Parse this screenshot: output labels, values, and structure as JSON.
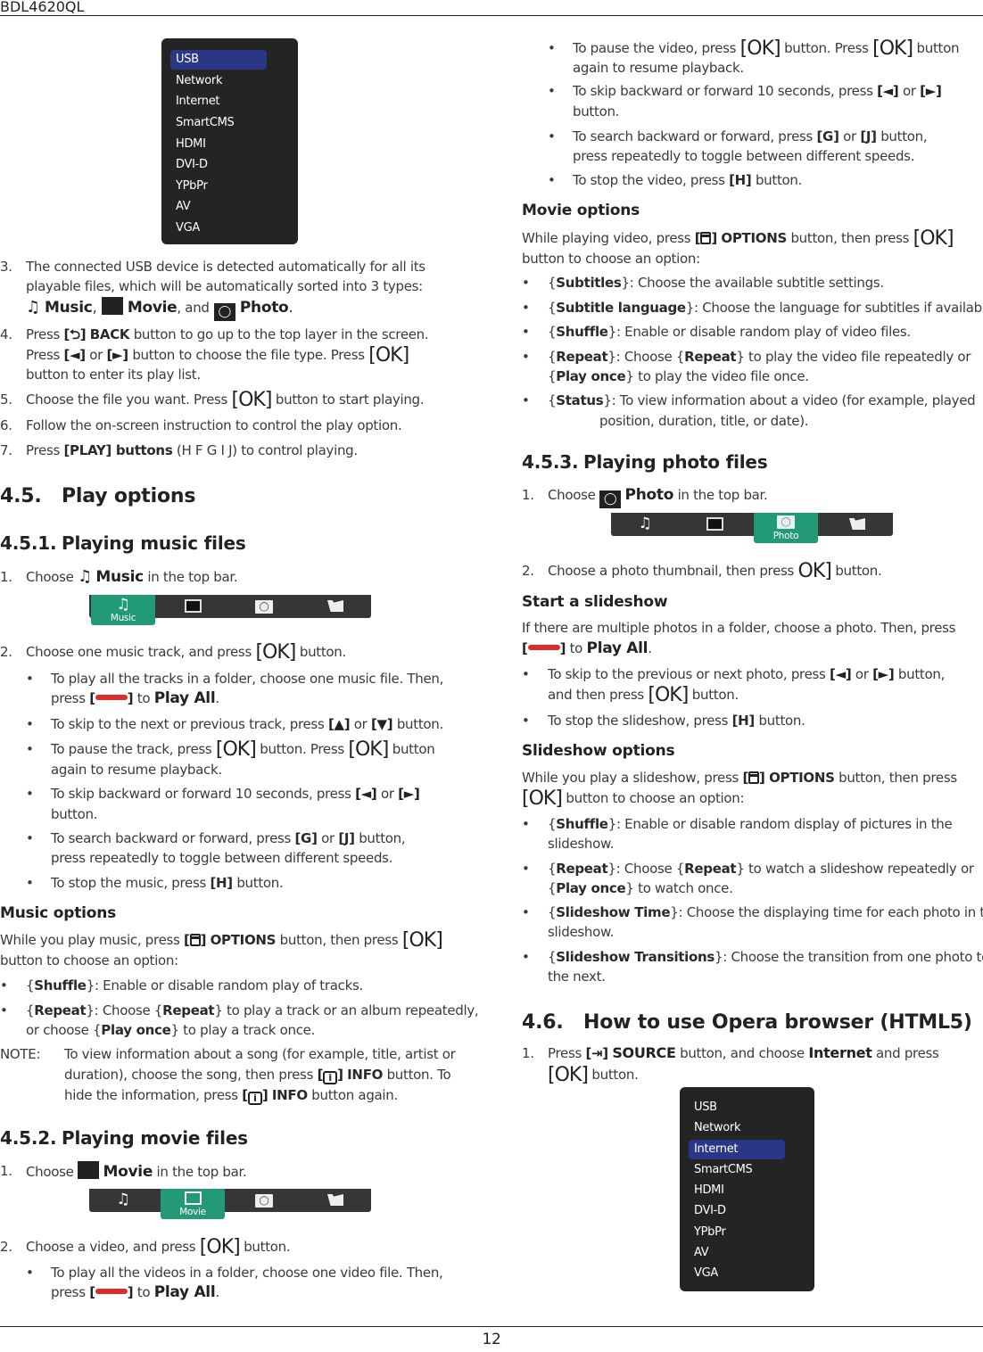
{
  "header": {
    "model": "BDL4620QL"
  },
  "footer": {
    "page_number": "12"
  },
  "source_menu_1": {
    "items": [
      "USB",
      "Network",
      "Internet",
      "SmartCMS",
      "HDMI",
      "DVI-D",
      "YPbPr",
      "AV",
      "VGA"
    ],
    "selected": "USB",
    "selected_color": "#2a3686"
  },
  "source_menu_2": {
    "items": [
      "USB",
      "Network",
      "Internet",
      "SmartCMS",
      "HDMI",
      "DVI-D",
      "YPbPr",
      "AV",
      "VGA"
    ],
    "selected": "Internet"
  },
  "steps_intro": {
    "s3_num": "3.",
    "s3_l1": "The connected USB device is detected automatically for all its",
    "s3_l2": "playable files, which will be automatically sorted into 3 types:",
    "music": "Music",
    "movie": "Movie",
    "and": ", and",
    "photo": "Photo",
    "s4_num": "4.",
    "s4_press": "Press",
    "s4_back": "BACK",
    "s4_l1_rest": "button to go up to the top layer in the screen.",
    "s4_l2_a": "Press",
    "s4_l2_or": "or",
    "s4_l2_b": "button to choose the file type. Press",
    "s4_l3": "button to enter its play list.",
    "s5_num": "5.",
    "s5_a": "Choose the file you want. Press",
    "s5_b": "button to start playing.",
    "s6_num": "6.",
    "s6": "Follow the on-screen instruction to control the play option.",
    "s7_num": "7.",
    "s7_a": "Press",
    "s7_play": "[PLAY] buttons",
    "s7_keys": "(H F G I J)",
    "s7_b": "to control playing."
  },
  "sections": {
    "s45_num": "4.5.",
    "s45_title": "Play options",
    "s451_num": "4.5.1.",
    "s451_title": "Playing music files",
    "s452_num": "4.5.2.",
    "s452_title": "Playing movie files",
    "s453_num": "4.5.3.",
    "s453_title": "Playing photo files",
    "s46_num": "4.6.",
    "s46_title": "How to use Opera browser (HTML5)"
  },
  "topbar": {
    "tabs": [
      "Music",
      "Movie",
      "Photo",
      "Files"
    ],
    "active_color": "#229977"
  },
  "music": {
    "step1_num": "1.",
    "step1_a": "Choose",
    "step1_label": "Music",
    "step1_b": "in the top bar.",
    "step2_num": "2.",
    "step2_a": "Choose one music track, and press",
    "step2_b": "button.",
    "b1_l1": "To play all the tracks in a folder, choose one music file. Then,",
    "b1_l2a": "press",
    "b1_to": "to",
    "play_all": "Play All",
    "b2_a": "To skip to the next or previous track, press",
    "b2_or": "or",
    "b2_b": "button.",
    "b3_a": "To pause the track, press",
    "b3_b": "button. Press",
    "b3_c": "button",
    "b3_l2": "again to resume playback.",
    "b4_a": "To skip backward or forward 10 seconds, press",
    "b4_or": "or",
    "b4_l2": "button.",
    "b5_a": "To search backward or forward, press",
    "b5_g": "[G]",
    "b5_or": "or",
    "b5_j": "[J]",
    "b5_b": "button,",
    "b5_l2": "press repeatedly to toggle between different speeds.",
    "b6_a": "To stop the music, press",
    "b6_h": "[H]",
    "b6_b": "button.",
    "opt_title": "Music options",
    "opt_l1a": "While you play music, press",
    "opt_options": "OPTIONS",
    "opt_l1b": "button, then press",
    "opt_l2": "button to choose an option:",
    "o1_name": "Shuffle",
    "o1_desc": ": Enable or disable random play of tracks.",
    "o2_name": "Repeat",
    "o2_a": ": Choose",
    "o2_b": "to play a track or an album repeatedly,",
    "o2_l2a": "or choose",
    "o2_playonce": "Play once",
    "o2_l2b": "to play a track once.",
    "note_label": "NOTE:",
    "note_l1": "To view information about a song (for example, title, artist or",
    "note_l2a": "duration), choose the song, then press",
    "note_info": "INFO",
    "note_l2b": "button. To",
    "note_l3a": "hide the information, press",
    "note_l3b": "button again."
  },
  "movie": {
    "step1_num": "1.",
    "step1_a": "Choose",
    "step1_label": "Movie",
    "step1_b": "in the top bar.",
    "step2_num": "2.",
    "step2_a": "Choose a video, and press",
    "step2_b": "button.",
    "b1_l1": "To play all the videos in a folder, choose one video file. Then,",
    "b1_l2a": "press",
    "b1_to": "to",
    "play_all": "Play All",
    "b2_a": "To pause the video, press",
    "b2_b": "button. Press",
    "b2_c": "button",
    "b2_l2": "again to resume playback.",
    "b3_a": "To skip backward or forward 10 seconds, press",
    "b3_or": "or",
    "b3_l2": "button.",
    "b4_a": "To search backward or forward, press",
    "b4_g": "[G]",
    "b4_or": "or",
    "b4_j": "[J]",
    "b4_b": "button,",
    "b4_l2": "press repeatedly to toggle between different speeds.",
    "b5_a": "To stop the video, press",
    "b5_h": "[H]",
    "b5_b": "button.",
    "opt_title": "Movie options",
    "opt_l1a": "While playing video, press",
    "opt_options": "OPTIONS",
    "opt_l1b": "button, then press",
    "opt_l2": "button to choose an option:",
    "o1_name": "Subtitles",
    "o1_desc": ": Choose the available subtitle settings.",
    "o2_name": "Subtitle language",
    "o2_desc": ": Choose the language for subtitles if available.",
    "o3_name": "Shuffle",
    "o3_desc": ": Enable or disable random play of video files.",
    "o4_name": "Repeat",
    "o4_a": ": Choose",
    "o4_b": "to play the video file repeatedly or",
    "o4_playonce": "Play once",
    "o4_l2b": "to play the video file once.",
    "o5_name": "Status",
    "o5_l1": ": To view information about a video (for example, played",
    "o5_l2": "position, duration, title, or date)."
  },
  "photo": {
    "step1_num": "1.",
    "step1_a": "Choose",
    "step1_label": "Photo",
    "step1_b": "in the top bar.",
    "step2_num": "2.",
    "step2_a": "Choose a photo thumbnail, then press",
    "step2_b": "button.",
    "slide_title": "Start a slideshow",
    "slide_l1": "If there are multiple photos in a folder, choose a photo. Then, press",
    "slide_to": "to",
    "play_all": "Play All",
    "b1_a": "To skip to the previous or next photo, press",
    "b1_or": "or",
    "b1_b": "button,",
    "b1_l2a": "and then press",
    "b1_l2b": "button.",
    "b2_a": "To stop the slideshow, press",
    "b2_h": "[H]",
    "b2_b": "button.",
    "opt_title": "Slideshow options",
    "opt_l1a": "While you play a slideshow, press",
    "opt_options": "OPTIONS",
    "opt_l1b": "button, then press",
    "opt_l2": "button to choose an option:",
    "o1_name": "Shuffle",
    "o1_l1": ": Enable or disable random display of pictures in the",
    "o1_l2": "slideshow.",
    "o2_name": "Repeat",
    "o2_a": ": Choose",
    "o2_b": "to watch a slideshow repeatedly or",
    "o2_playonce": "Play once",
    "o2_l2b": "to watch once.",
    "o3_name": "Slideshow Time",
    "o3_l1": ": Choose the displaying time for each photo in the",
    "o3_l2": "slideshow.",
    "o4_name": "Slideshow Transitions",
    "o4_l1": ": Choose the transition from one photo to",
    "o4_l2": "the next."
  },
  "opera": {
    "step1_num": "1.",
    "step1_a": "Press",
    "source": "SOURCE",
    "step1_b": "button, and choose",
    "internet": "Internet",
    "step1_c": "and press",
    "step1_l2": "button."
  },
  "symbols": {
    "ok": "OK",
    "bullet": "•",
    "play_all_color": "#dd2a2a"
  }
}
